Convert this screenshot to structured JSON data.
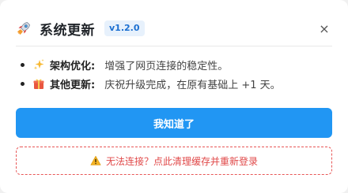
{
  "dialog": {
    "title": "系统更新",
    "version": "v1.2.0",
    "close_label": "×",
    "icons": {
      "header": "rocket-icon",
      "close": "close-icon"
    }
  },
  "notes": [
    {
      "icon": "sparkles-icon",
      "label": "架构优化:",
      "text": "增强了网页连接的稳定性。"
    },
    {
      "icon": "gift-icon",
      "label": "其他更新:",
      "text": "庆祝升级完成，在原有基础上 +1 天。"
    }
  ],
  "actions": {
    "confirm_label": "我知道了",
    "warning_text": "无法连接？点此清理缓存并重新登录",
    "warning_icon": "warning-icon"
  },
  "colors": {
    "primary": "#2196f3",
    "badge_text": "#1b6fd1",
    "badge_bg": "#e7f1fc",
    "warning": "#e04848"
  }
}
